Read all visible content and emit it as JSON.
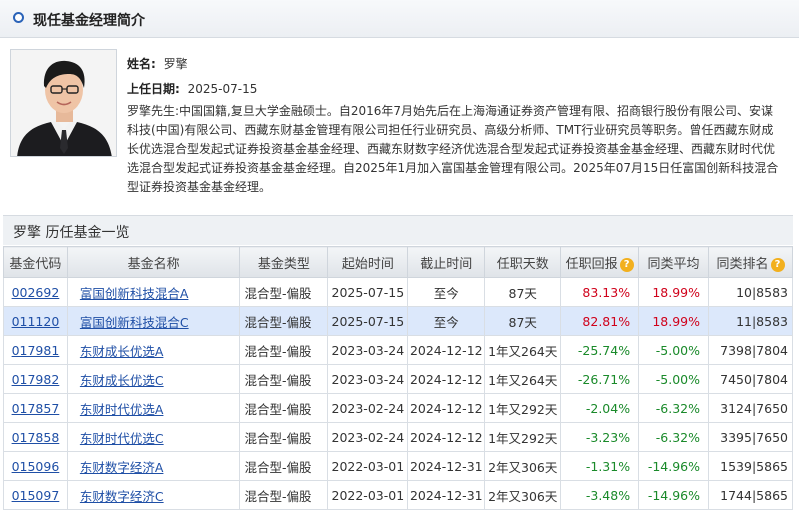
{
  "section": {
    "title": "现任基金经理简介"
  },
  "manager": {
    "name_label": "姓名:",
    "name": "罗擎",
    "start_label": "上任日期:",
    "start_date": "2025-07-15",
    "bio": "罗擎先生:中国国籍,复旦大学金融硕士。自2016年7月始先后在上海海通证券资产管理有限、招商银行股份有限公司、安谋科技(中国)有限公司、西藏东财基金管理有限公司担任行业研究员、高级分析师、TMT行业研究员等职务。曾任西藏东财成长优选混合型发起式证券投资基金基金经理、西藏东财数字经济优选混合型发起式证券投资基金基金经理、西藏东财时代优选混合型发起式证券投资基金基金经理。自2025年1月加入富国基金管理有限公司。2025年07月15日任富国创新科技混合型证券投资基金基金经理。"
  },
  "history": {
    "title": "罗擎  历任基金一览",
    "headers": [
      "基金代码",
      "基金名称",
      "基金类型",
      "起始时间",
      "截止时间",
      "任职天数",
      "任职回报",
      "同类平均",
      "同类排名"
    ],
    "rows": [
      {
        "code": "002692",
        "name": "富国创新科技混合A",
        "type": "混合型-偏股",
        "start": "2025-07-15",
        "end": "至今",
        "days": "87天",
        "ret": "83.13%",
        "avg": "18.99%",
        "rank": "10|8583"
      },
      {
        "code": "011120",
        "name": "富国创新科技混合C",
        "type": "混合型-偏股",
        "start": "2025-07-15",
        "end": "至今",
        "days": "87天",
        "ret": "82.81%",
        "avg": "18.99%",
        "rank": "11|8583"
      },
      {
        "code": "017981",
        "name": "东财成长优选A",
        "type": "混合型-偏股",
        "start": "2023-03-24",
        "end": "2024-12-12",
        "days": "1年又264天",
        "ret": "-25.74%",
        "avg": "-5.00%",
        "rank": "7398|7804"
      },
      {
        "code": "017982",
        "name": "东财成长优选C",
        "type": "混合型-偏股",
        "start": "2023-03-24",
        "end": "2024-12-12",
        "days": "1年又264天",
        "ret": "-26.71%",
        "avg": "-5.00%",
        "rank": "7450|7804"
      },
      {
        "code": "017857",
        "name": "东财时代优选A",
        "type": "混合型-偏股",
        "start": "2023-02-24",
        "end": "2024-12-12",
        "days": "1年又292天",
        "ret": "-2.04%",
        "avg": "-6.32%",
        "rank": "3124|7650"
      },
      {
        "code": "017858",
        "name": "东财时代优选C",
        "type": "混合型-偏股",
        "start": "2023-02-24",
        "end": "2024-12-12",
        "days": "1年又292天",
        "ret": "-3.23%",
        "avg": "-6.32%",
        "rank": "3395|7650"
      },
      {
        "code": "015096",
        "name": "东财数字经济A",
        "type": "混合型-偏股",
        "start": "2022-03-01",
        "end": "2024-12-31",
        "days": "2年又306天",
        "ret": "-1.31%",
        "avg": "-14.96%",
        "rank": "1539|5865"
      },
      {
        "code": "015097",
        "name": "东财数字经济C",
        "type": "混合型-偏股",
        "start": "2022-03-01",
        "end": "2024-12-31",
        "days": "2年又306天",
        "ret": "-3.48%",
        "avg": "-14.96%",
        "rank": "1744|5865"
      }
    ]
  },
  "icons": {
    "help": "question-icon",
    "section_bullet": "circle-bullet-icon"
  },
  "colors": {
    "positive": "#d0021b",
    "negative": "#1a8a2a",
    "link": "#1f4fa6",
    "selected_row": "#dce8fb",
    "help_icon": "#f2b01e"
  }
}
